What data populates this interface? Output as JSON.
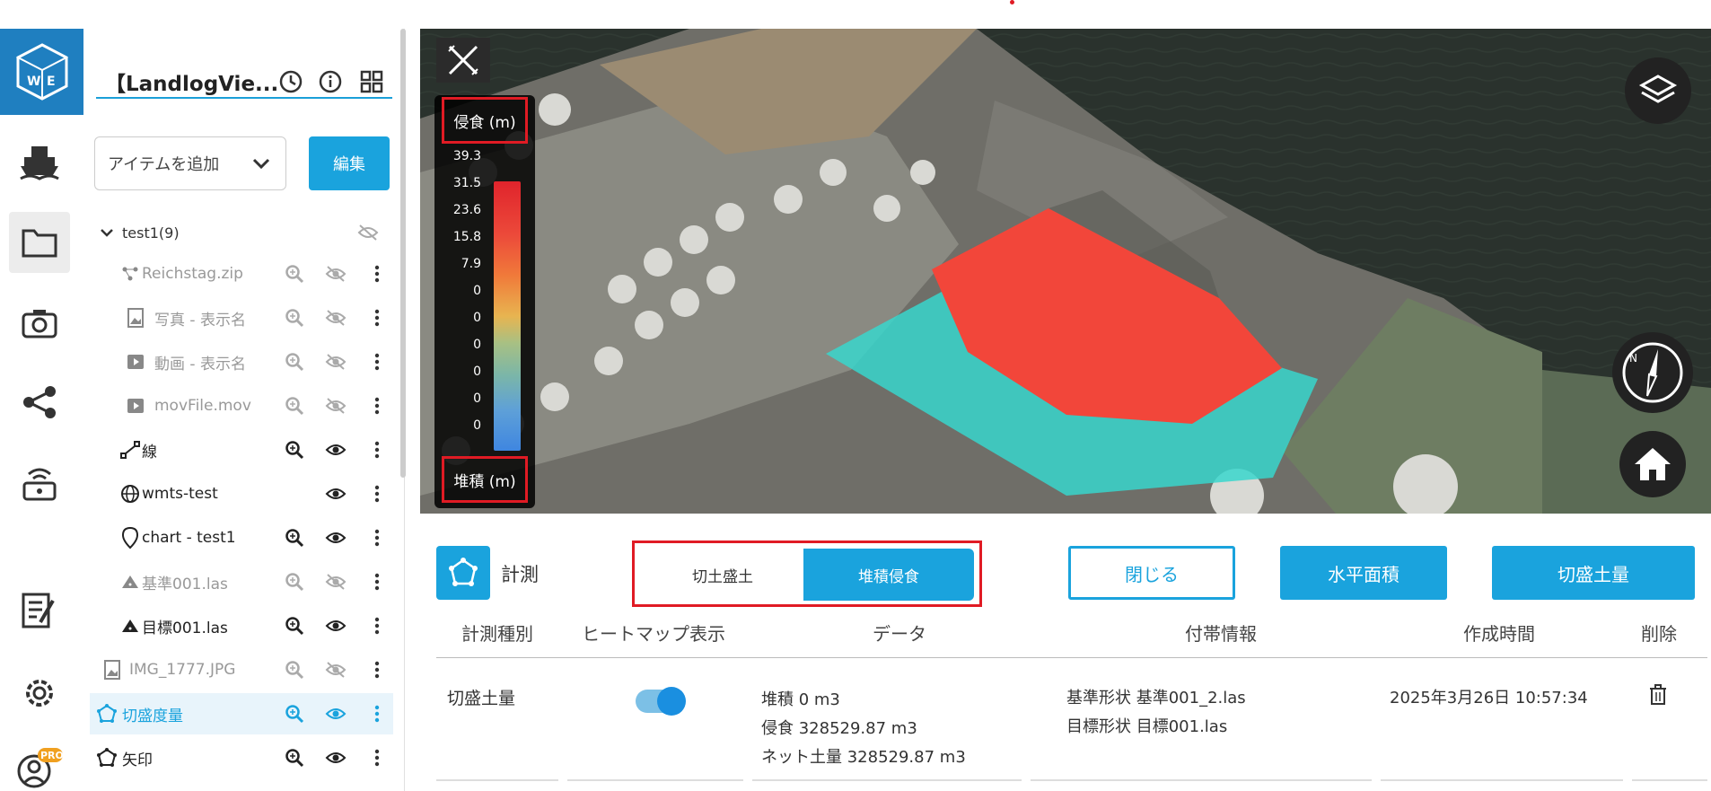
{
  "project": {
    "title": "【LandlogVie..."
  },
  "sidebar": {
    "add_item_placeholder": "アイテムを追加",
    "edit_label": "編集",
    "group": {
      "label": "test1(9)"
    },
    "items": [
      {
        "label": "Reichstag.zip",
        "icon": "point-cloud-icon",
        "dim": true
      },
      {
        "label": "写真 - 表示名",
        "icon": "image-icon",
        "dim": true
      },
      {
        "label": "動画 - 表示名",
        "icon": "video-icon",
        "dim": true
      },
      {
        "label": "movFile.mov",
        "icon": "video-icon",
        "dim": true
      },
      {
        "label": "線",
        "icon": "line-icon",
        "dim": false
      },
      {
        "label": "wmts-test",
        "icon": "globe-icon",
        "dim": false
      },
      {
        "label": "chart - test1",
        "icon": "pin-icon",
        "dim": false
      },
      {
        "label": "基準001.las",
        "icon": "triangle-icon",
        "dim": true
      },
      {
        "label": "目標001.las",
        "icon": "triangle-icon",
        "dim": false
      },
      {
        "label": "IMG_1777.JPG",
        "icon": "image-icon",
        "dim": true
      },
      {
        "label": "切盛度量",
        "icon": "measure-icon",
        "dim": false,
        "selected": true
      },
      {
        "label": "矢印",
        "icon": "measure-icon",
        "dim": false
      }
    ]
  },
  "legend": {
    "top_label": "侵食 (m)",
    "bottom_label": "堆積 (m)",
    "ticks": [
      "39.3",
      "31.5",
      "23.6",
      "15.8",
      "7.9",
      "0",
      "0",
      "0",
      "0",
      "0",
      "0"
    ]
  },
  "panel": {
    "title": "計測",
    "toggle": {
      "off_label": "切土盛土",
      "on_label": "堆積侵食"
    },
    "buttons": {
      "close": "閉じる",
      "area": "水平面積",
      "cutfill": "切盛土量"
    },
    "columns": [
      "計測種別",
      "ヒートマップ表示",
      "データ",
      "付帯情報",
      "作成時間",
      "削除"
    ],
    "row": {
      "type": "切盛土量",
      "heatmap_on": true,
      "data": [
        "堆積 0 m3",
        "侵食 328529.87 m3",
        "ネット土量 328529.87 m3"
      ],
      "info": [
        "基準形状 基準001_2.las",
        "目標形状 目標001.las"
      ],
      "created": "2025年3月26日 10:57:34"
    }
  },
  "colors": {
    "accent": "#1aa3dd",
    "brand": "#1f7fc0",
    "highlight_red": "#e01b24",
    "erosion": "#f2463a",
    "deposition": "#38d6cc"
  }
}
